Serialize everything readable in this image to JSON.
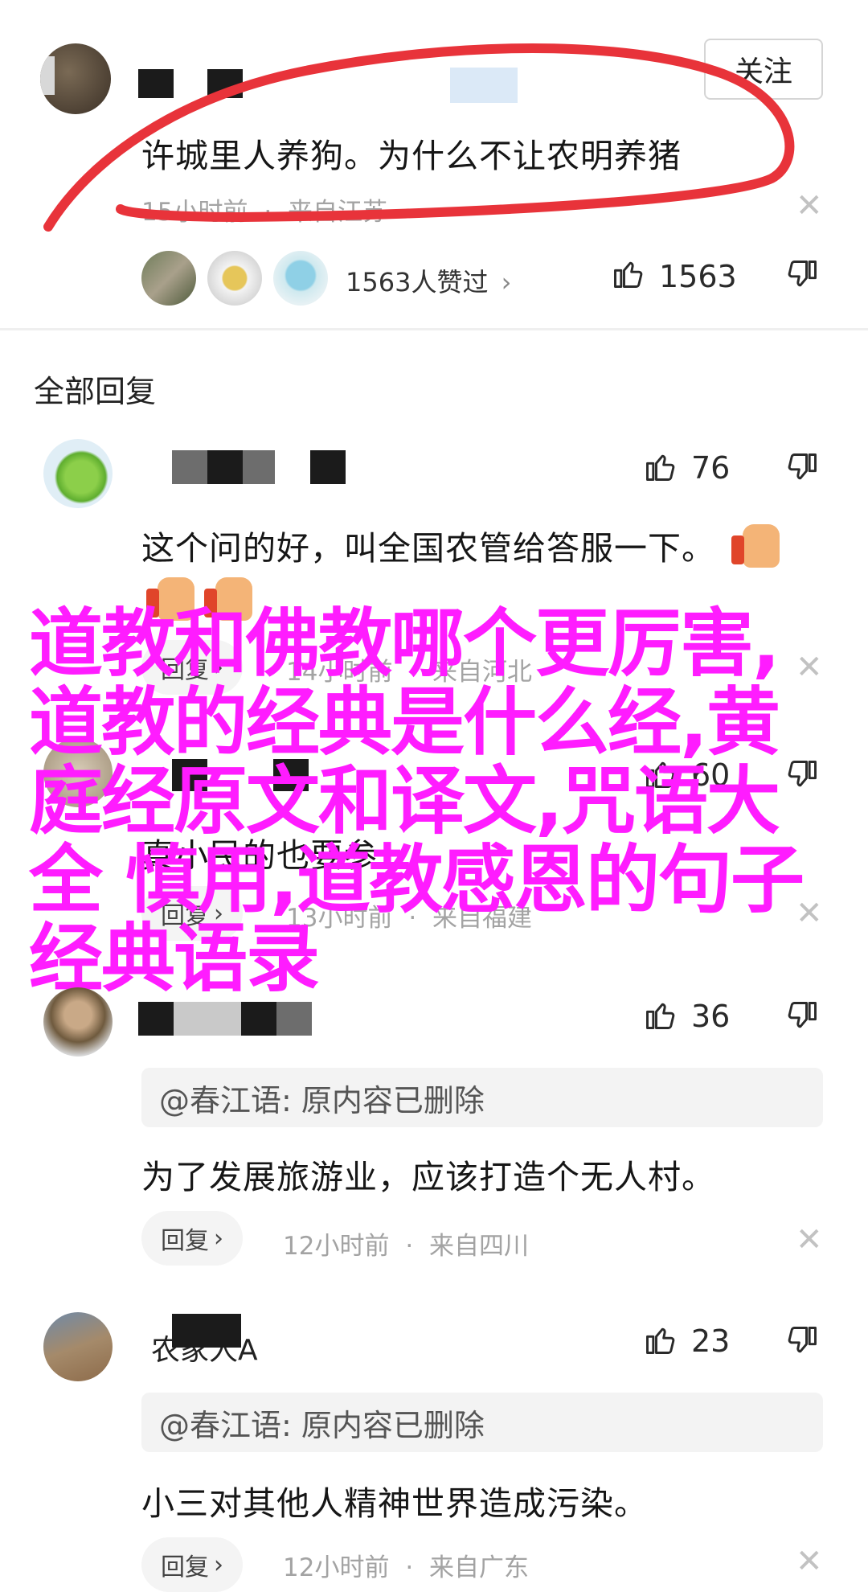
{
  "top_post": {
    "follow_label": "关注",
    "content": "许城里人养狗。为什么不让农明养猪",
    "time": "15小时前",
    "location": "来自江苏",
    "separator": "·",
    "likers_text": "1563人赞过",
    "like_count": "1563"
  },
  "section_title": "全部回复",
  "replies": [
    {
      "likes": "76",
      "content": "这个问的好，叫全国农管给答服一下。",
      "reply_label": "回复",
      "time": "14小时前",
      "location": "来自河北"
    },
    {
      "likes": "60",
      "content": "真小民的也要参",
      "reply_label": "回复",
      "time": "13小时前",
      "location": "来自福建"
    },
    {
      "likes": "36",
      "quote": "@春江语: 原内容已删除",
      "content": "为了发展旅游业，应该打造个无人村。",
      "reply_label": "回复",
      "time": "12小时前",
      "location": "来自四川"
    },
    {
      "username": "农家人A",
      "likes": "23",
      "quote": "@春江语: 原内容已删除",
      "content": "小三对其他人精神世界造成污染。",
      "reply_label": "回复",
      "time": "12小时前",
      "location": "来自广东"
    }
  ],
  "overlay": {
    "title": "道教和佛教哪个更厉害,道教的经典是什么经,黄庭经原文和译文,咒语大全 慎用,道教感恩的句子经典语录"
  },
  "colors": {
    "overlay_text": "#ff1cff",
    "annotation_red": "#e8333a",
    "muted_text": "#a3a3a3"
  },
  "icons": [
    "thumb-up-icon",
    "thumb-down-icon",
    "close-icon",
    "chevron-right-icon"
  ]
}
